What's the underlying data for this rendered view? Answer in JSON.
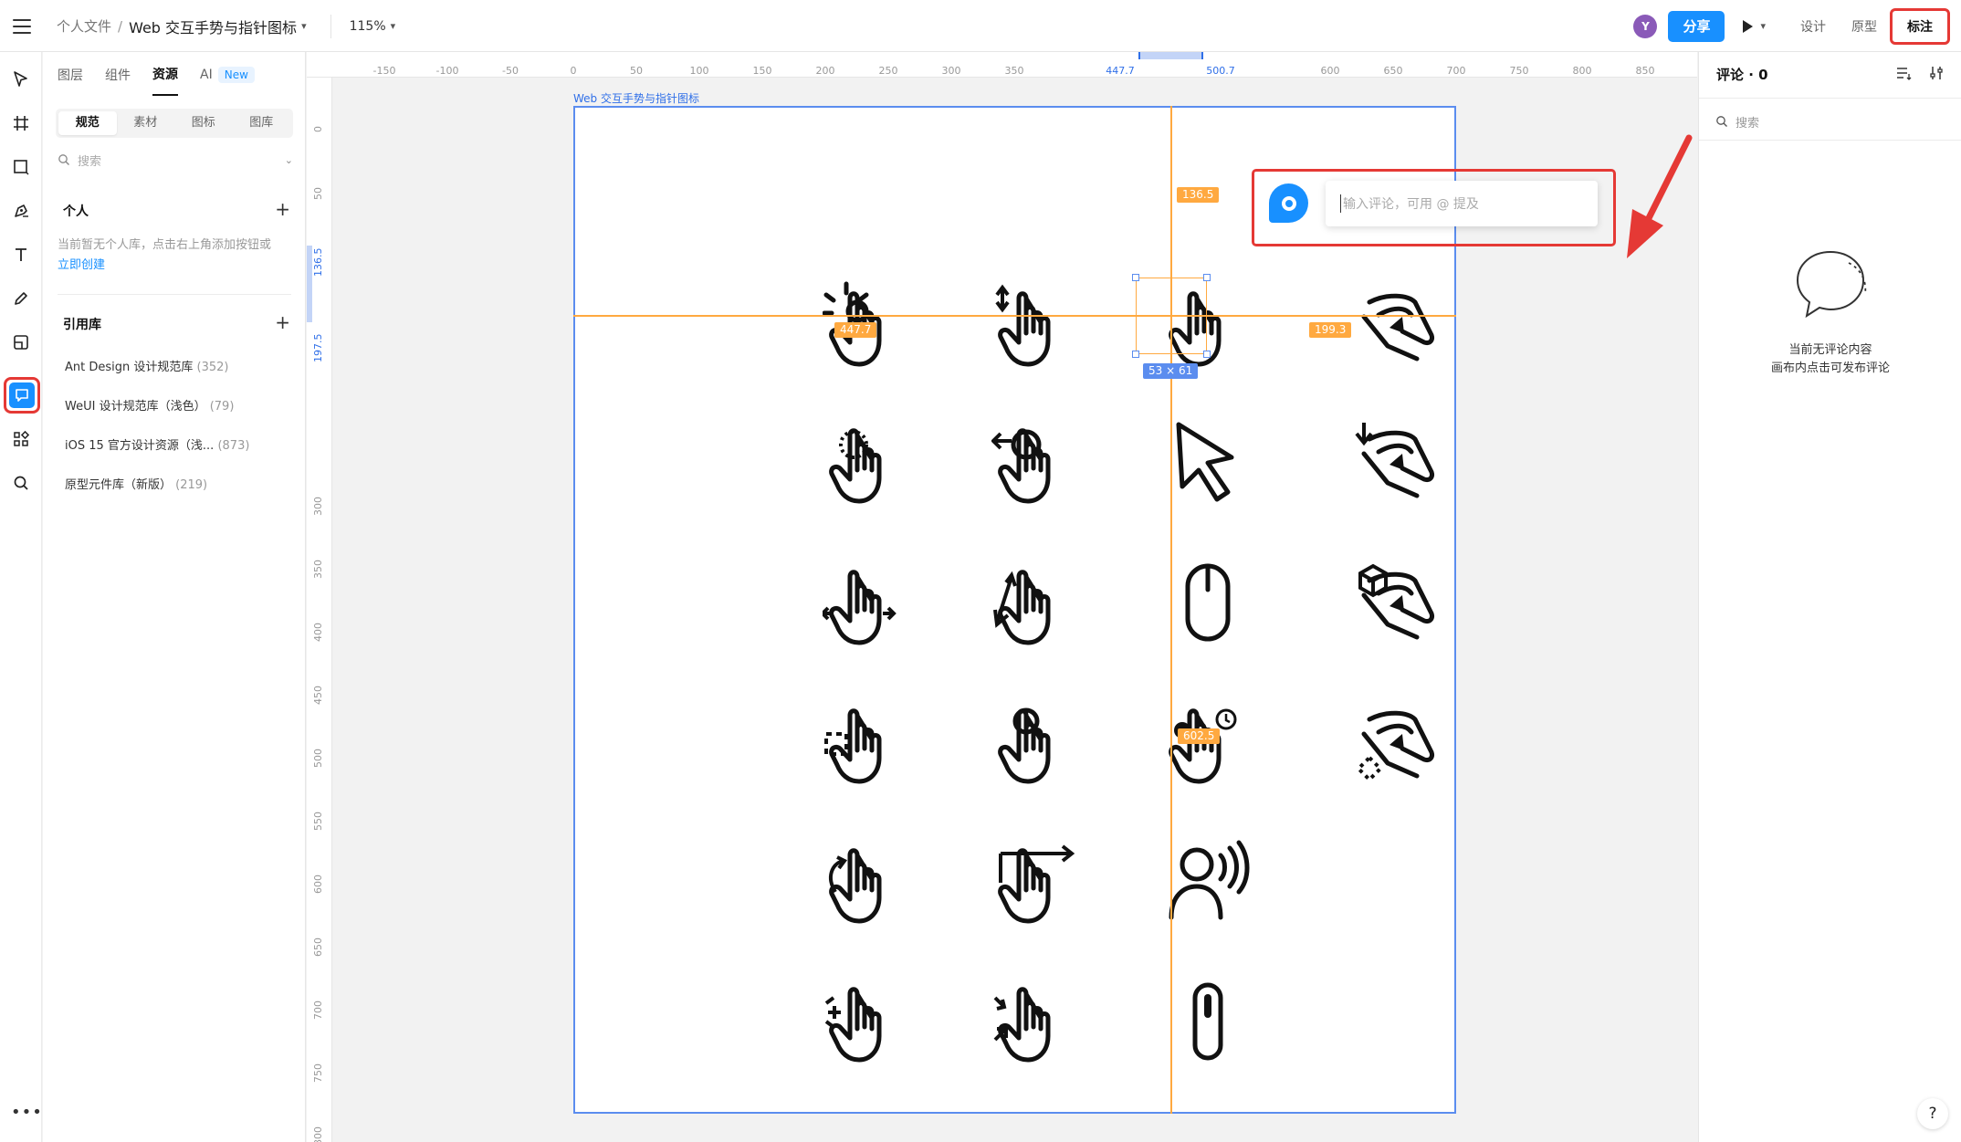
{
  "header": {
    "breadcrumb_parent": "个人文件",
    "breadcrumb_sep": "/",
    "file_name": "Web 交互手势与指针图标",
    "zoom": "115%",
    "avatar_letter": "Y",
    "share_label": "分享",
    "modes": [
      "设计",
      "原型",
      "标注"
    ],
    "active_mode": "标注"
  },
  "rail": {
    "tools": [
      "move-tool-icon",
      "frame-tool-icon",
      "shape-tool-icon",
      "pen-tool-icon",
      "text-tool-icon",
      "pencil-tool-icon",
      "component-tool-icon",
      "comment-tool-icon",
      "plugins-icon",
      "search-icon"
    ],
    "active_tool": "comment-tool-icon",
    "more_label": "•••"
  },
  "left_panel": {
    "tabs": [
      "图层",
      "组件",
      "资源",
      "AI"
    ],
    "active_tab": "资源",
    "new_badge": "New",
    "subtabs": [
      "规范",
      "素材",
      "图标",
      "图库"
    ],
    "active_subtab": "规范",
    "search_placeholder": "搜索",
    "personal_heading": "个人",
    "personal_empty_text": "当前暂无个人库，点击右上角添加按钮或",
    "personal_create_link": "立即创建",
    "library_heading": "引用库",
    "libraries": [
      {
        "name": "Ant Design 设计规范库",
        "count": "(352)"
      },
      {
        "name": "WeUI 设计规范库（浅色）",
        "count": "(79)"
      },
      {
        "name": "iOS 15 官方设计资源（浅...",
        "count": "(873)"
      },
      {
        "name": "原型元件库（新版）",
        "count": "(219)"
      }
    ]
  },
  "canvas": {
    "ruler_top": [
      "-150",
      "-100",
      "-50",
      "0",
      "50",
      "100",
      "150",
      "200",
      "250",
      "300",
      "350",
      "447.7",
      "500.7",
      "600",
      "650",
      "700",
      "750",
      "800",
      "850"
    ],
    "ruler_top_highlight": [
      "447.7",
      "500.7"
    ],
    "ruler_left": [
      "0",
      "50",
      "136.5",
      "197.5",
      "300",
      "350",
      "400",
      "450",
      "500",
      "550",
      "600",
      "650",
      "700",
      "750",
      "800"
    ],
    "ruler_left_highlight": [
      "136.5",
      "197.5"
    ],
    "frame_title": "Web 交互手势与指针图标",
    "measure_labels": {
      "top": "136.5",
      "left": "447.7",
      "right": "199.3",
      "bottom": "602.5",
      "size": "53 × 61"
    },
    "icons": [
      "tap-gesture-icon",
      "vertical-drag-gesture-icon",
      "pointer-hand-icon",
      "pinch-hand-icon",
      "double-tap-gesture-icon",
      "swipe-left-gesture-icon",
      "arrow-cursor-icon",
      "pinch-down-hand-icon",
      "horizontal-pan-hand-icon",
      "diagonal-drag-gesture-icon",
      "mouse-icon",
      "cube-pinch-icon",
      "select-area-gesture-icon",
      "press-gesture-icon",
      "long-press-gesture-icon",
      "spread-dots-pinch-icon",
      "rotate-gesture-icon",
      "swipe-right-gesture-icon",
      "voice-user-icon",
      "zoom-out-gesture-icon",
      "zoom-in-gesture-icon",
      "scroll-mouse-icon"
    ],
    "comment_placeholder": "输入评论，可用 @ 提及"
  },
  "right_panel": {
    "title": "评论 · 0",
    "search_placeholder": "搜索",
    "empty_line1": "当前无评论内容",
    "empty_line2": "画布内点击可发布评论",
    "help": "?"
  },
  "colors": {
    "accent": "#1890ff",
    "highlight_red": "#e53935",
    "guide_orange": "#ffa940",
    "frame_blue": "#5b8def"
  }
}
